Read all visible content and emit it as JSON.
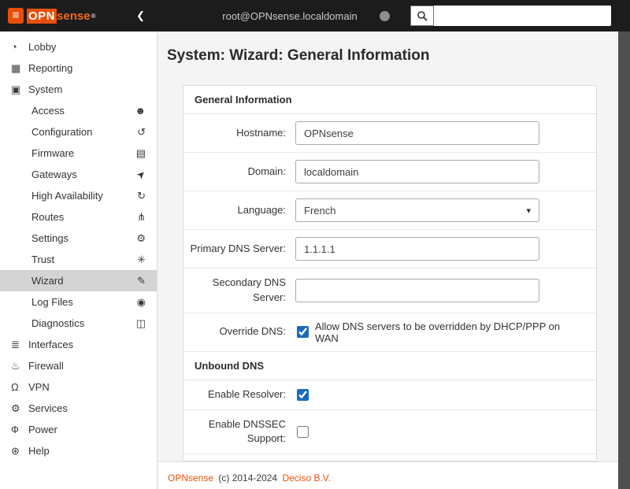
{
  "header": {
    "logo": {
      "mark": "≡",
      "opn": "OPN",
      "sense": "sense",
      "reg": "®"
    },
    "collapse_glyph": "❮",
    "session": "root@OPNsense.localdomain",
    "search": {
      "value": "",
      "placeholder": ""
    }
  },
  "sidebar": {
    "items_top": [
      {
        "label": "Lobby",
        "glyph": "◔"
      },
      {
        "label": "Reporting",
        "glyph": "▦"
      },
      {
        "label": "System",
        "glyph": "▣"
      }
    ],
    "system_children": [
      {
        "label": "Access",
        "glyph": "☻"
      },
      {
        "label": "Configuration",
        "glyph": "↺"
      },
      {
        "label": "Firmware",
        "glyph": "▤"
      },
      {
        "label": "Gateways",
        "glyph": "➤"
      },
      {
        "label": "High Availability",
        "glyph": "↻"
      },
      {
        "label": "Routes",
        "glyph": "⋔"
      },
      {
        "label": "Settings",
        "glyph": "⚙"
      },
      {
        "label": "Trust",
        "glyph": "✳"
      },
      {
        "label": "Wizard",
        "glyph": "✎"
      },
      {
        "label": "Log Files",
        "glyph": "◉"
      },
      {
        "label": "Diagnostics",
        "glyph": "◫"
      }
    ],
    "items_bottom": [
      {
        "label": "Interfaces",
        "glyph": "≣"
      },
      {
        "label": "Firewall",
        "glyph": "♨"
      },
      {
        "label": "VPN",
        "glyph": "Ω"
      },
      {
        "label": "Services",
        "glyph": "⚙"
      },
      {
        "label": "Power",
        "glyph": "Ф"
      },
      {
        "label": "Help",
        "glyph": "⊛"
      }
    ]
  },
  "page": {
    "title": "System: Wizard: General Information"
  },
  "form": {
    "section_general": "General Information",
    "hostname": {
      "label": "Hostname:",
      "value": "OPNsense"
    },
    "domain": {
      "label": "Domain:",
      "value": "localdomain"
    },
    "language": {
      "label": "Language:",
      "value": "French",
      "caret": "▾"
    },
    "dns_primary": {
      "label": "Primary DNS Server:",
      "value": "1.1.1.1"
    },
    "dns_secondary": {
      "label": "Secondary DNS Server:",
      "value": ""
    },
    "override_dns": {
      "label": "Override DNS:",
      "checked": true,
      "text": "Allow DNS servers to be overridden by DHCP/PPP on WAN"
    },
    "section_unbound": "Unbound DNS",
    "enable_resolver": {
      "label": "Enable Resolver:",
      "checked": true
    },
    "enable_dnssec": {
      "label": "Enable DNSSEC Support:",
      "checked": false
    }
  },
  "footer": {
    "brand": "OPNsense",
    "text": "(c) 2014-2024",
    "company": "Deciso B.V."
  },
  "colors": {
    "accent_orange": "#e8500a",
    "checkbox_blue": "#1a6bbc",
    "header_bg": "#1c1c1c"
  }
}
